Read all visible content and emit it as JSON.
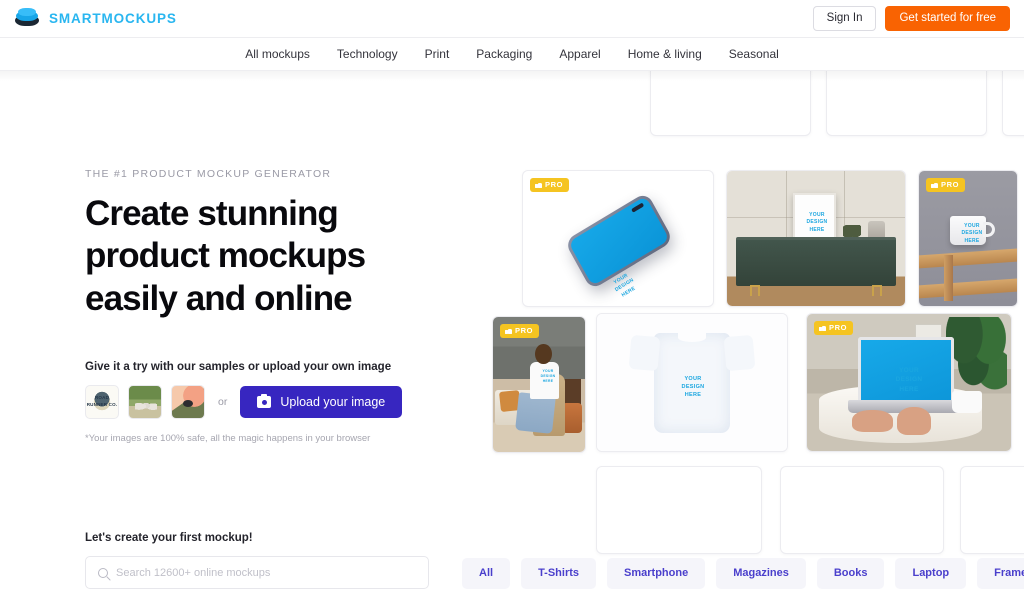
{
  "brand": {
    "name": "SMARTMOCKUPS",
    "logo_icon": "stacked-layers-icon",
    "color": "#29b6f0"
  },
  "topbar": {
    "sign_in_label": "Sign In",
    "cta_label": "Get started for free",
    "cta_color": "#f96302"
  },
  "nav": {
    "items": [
      {
        "label": "All mockups"
      },
      {
        "label": "Technology"
      },
      {
        "label": "Print"
      },
      {
        "label": "Packaging"
      },
      {
        "label": "Apparel"
      },
      {
        "label": "Home & living"
      },
      {
        "label": "Seasonal"
      }
    ]
  },
  "hero": {
    "eyebrow": "THE #1 PRODUCT MOCKUP GENERATOR",
    "headline_line1": "Create stunning",
    "headline_line2": "product mockups",
    "headline_line3": "easily and online"
  },
  "try": {
    "label": "Give it a try with our samples or upload your own image",
    "samples": [
      {
        "name": "sample-road-runner-logo",
        "caption": "ROAD RUNNER CO."
      },
      {
        "name": "sample-people-outdoors",
        "caption": ""
      },
      {
        "name": "sample-abstract-art",
        "caption": ""
      }
    ],
    "or_label": "or",
    "upload_label": "Upload your image",
    "upload_icon": "camera-icon",
    "upload_color": "#3726c0",
    "safety_note": "*Your images are 100% safe, all the magic happens in your browser"
  },
  "search": {
    "label": "Let's create your first mockup!",
    "placeholder": "Search 12600+ online mockups",
    "value": "",
    "icon": "search-icon"
  },
  "gallery": {
    "pro_badge_label": "PRO",
    "pro_badge_icon": "thumbs-up-icon",
    "pro_badge_color": "#f5c421",
    "design_placeholder": "YOUR\nDESIGN\nHERE",
    "design_text_color": "#1aa6e0",
    "items": [
      {
        "name": "mockup-card-placeholder-top-1",
        "kind": "placeholder",
        "pro": false,
        "alt": ""
      },
      {
        "name": "mockup-card-placeholder-top-2",
        "kind": "placeholder",
        "pro": false,
        "alt": ""
      },
      {
        "name": "mockup-card-placeholder-top-3",
        "kind": "placeholder",
        "pro": false,
        "alt": ""
      },
      {
        "name": "mockup-card-smartphone",
        "kind": "smartphone",
        "pro": true,
        "alt": "Smartphone mockup with blue screen"
      },
      {
        "name": "mockup-card-poster-interior",
        "kind": "interior",
        "pro": false,
        "alt": "Framed poster on green sideboard in interior"
      },
      {
        "name": "mockup-card-mug",
        "kind": "mug",
        "pro": true,
        "alt": "White mug on wooden bench"
      },
      {
        "name": "mockup-card-tshirt-model",
        "kind": "model",
        "pro": true,
        "alt": "Man in white t-shirt sitting on rattan chair"
      },
      {
        "name": "mockup-card-tshirt-flat",
        "kind": "tshirt",
        "pro": false,
        "alt": "White t-shirt flat lay"
      },
      {
        "name": "mockup-card-laptop",
        "kind": "laptop",
        "pro": true,
        "alt": "Laptop on table with hands typing"
      },
      {
        "name": "mockup-card-placeholder-bottom-1",
        "kind": "placeholder",
        "pro": false,
        "alt": ""
      },
      {
        "name": "mockup-card-placeholder-bottom-2",
        "kind": "placeholder",
        "pro": false,
        "alt": ""
      },
      {
        "name": "mockup-card-placeholder-bottom-3",
        "kind": "placeholder",
        "pro": false,
        "alt": ""
      }
    ]
  },
  "categories": {
    "chips": [
      {
        "label": "All"
      },
      {
        "label": "T-Shirts"
      },
      {
        "label": "Smartphone"
      },
      {
        "label": "Magazines"
      },
      {
        "label": "Books"
      },
      {
        "label": "Laptop"
      },
      {
        "label": "Frames"
      }
    ],
    "next_icon": "chevron-right-icon",
    "chip_color": "#4a3fcc"
  }
}
